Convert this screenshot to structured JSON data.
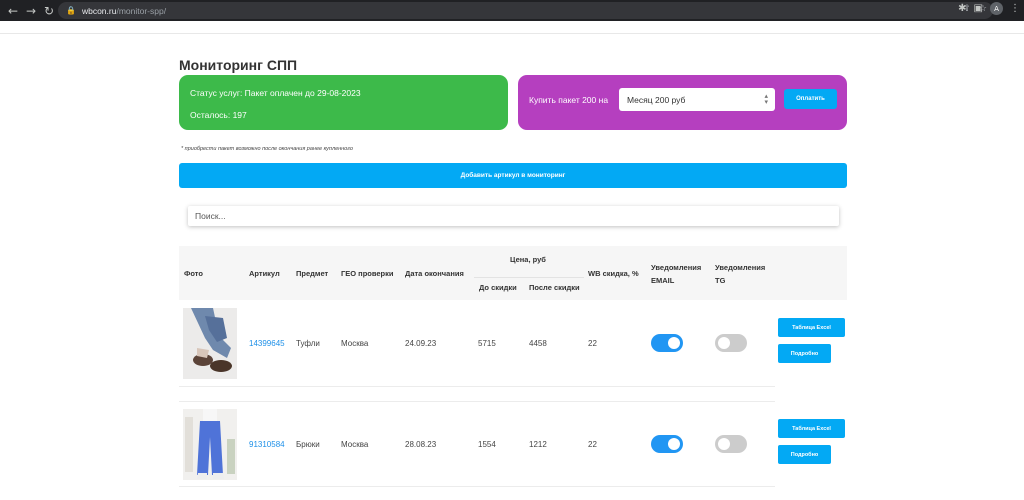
{
  "browser": {
    "url_host": "wbcon.ru",
    "url_path": "/monitor-spp/",
    "profile_initial": "A"
  },
  "page": {
    "title": "Мониторинг СПП"
  },
  "status_card": {
    "status_text": "Статус услуг: Пакет оплачен до 29-08-2023",
    "remaining_text": "Осталось: 197",
    "color": "#3dba4a"
  },
  "buy_card": {
    "label": "Купить пакет 200 на",
    "selected_option": "Месяц 200 руб",
    "pay_button": "Оплатить",
    "color": "#b53fbf"
  },
  "note": "* приобрести пакет возможно после окончания ранее купленного",
  "add_button": "Добавить артикул в мониторинг",
  "search": {
    "placeholder": "Поиск..."
  },
  "table": {
    "headers": {
      "photo": "Фото",
      "article": "Артикул",
      "subject": "Предмет",
      "geo": "ГЕО проверки",
      "end_date": "Дата окончания",
      "price_group": "Цена, руб",
      "price_before": "До скидки",
      "price_after": "После скидки",
      "wb_discount": "WB скидка, %",
      "notify_email_1": "Уведомления",
      "notify_email_2": "EMAIL",
      "notify_tg_1": "Уведомления",
      "notify_tg_2": "TG"
    },
    "rows": [
      {
        "article": "14399645",
        "subject": "Туфли",
        "geo": "Москва",
        "end_date": "24.09.23",
        "price_before": "5715",
        "price_after": "4458",
        "wb_discount": "22",
        "email_on": true,
        "tg_on": false,
        "excel_button": "Таблица Excel",
        "details_button": "Подробно"
      },
      {
        "article": "91310584",
        "subject": "Брюки",
        "geo": "Москва",
        "end_date": "28.08.23",
        "price_before": "1554",
        "price_after": "1212",
        "wb_discount": "22",
        "email_on": true,
        "tg_on": false,
        "excel_button": "Таблица Excel",
        "details_button": "Подробно"
      }
    ]
  },
  "colors": {
    "accent": "#03a9f4",
    "toggle_on": "#2196f3",
    "toggle_off": "#cccccc",
    "link": "#1e90e8"
  }
}
